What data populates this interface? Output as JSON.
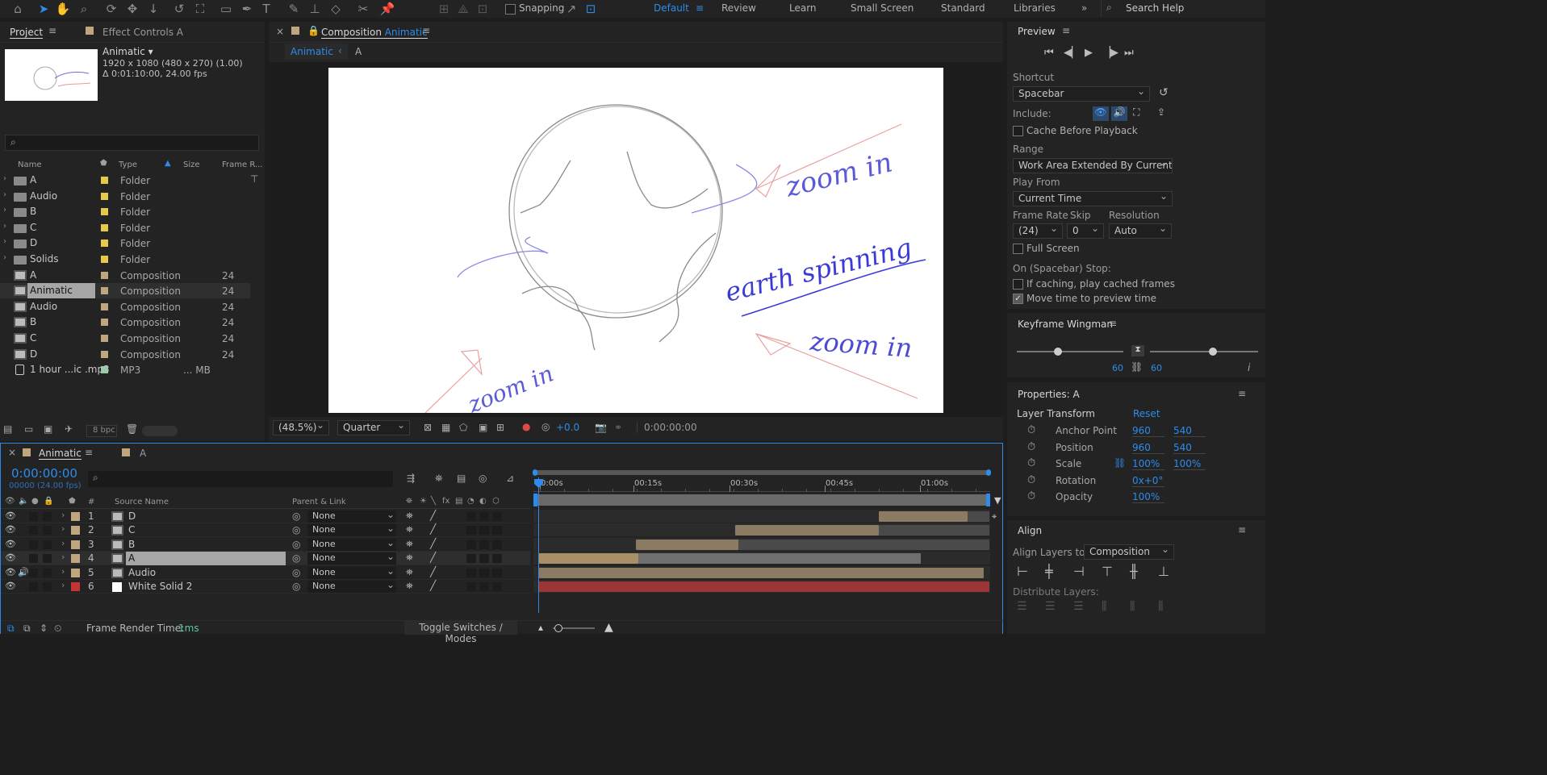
{
  "toolbar": {
    "snapping_label": "Snapping",
    "workspaces": [
      "Default",
      "Review",
      "Learn",
      "Small Screen",
      "Standard",
      "Libraries"
    ],
    "search_placeholder": "Search Help"
  },
  "project": {
    "tab_label": "Project",
    "effect_tab_label": "Effect Controls A",
    "comp_name": "Animatic",
    "comp_info_line1": "1920 x 1080  (480 x 270) (1.00)",
    "comp_info_line2": "Δ 0:01:10:00, 24.00 fps",
    "columns": {
      "name": "Name",
      "type": "Type",
      "size": "Size",
      "frame_rate": "Frame R..."
    },
    "items": [
      {
        "name": "A",
        "kind": "folder",
        "type": "Folder",
        "size": "",
        "fps": "",
        "color": "#e6c84a"
      },
      {
        "name": "Audio",
        "kind": "folder",
        "type": "Folder",
        "size": "",
        "fps": "",
        "color": "#e6c84a"
      },
      {
        "name": "B",
        "kind": "folder",
        "type": "Folder",
        "size": "",
        "fps": "",
        "color": "#e6c84a"
      },
      {
        "name": "C",
        "kind": "folder",
        "type": "Folder",
        "size": "",
        "fps": "",
        "color": "#e6c84a"
      },
      {
        "name": "D",
        "kind": "folder",
        "type": "Folder",
        "size": "",
        "fps": "",
        "color": "#e6c84a"
      },
      {
        "name": "Solids",
        "kind": "folder",
        "type": "Folder",
        "size": "",
        "fps": "",
        "color": "#e6c84a"
      },
      {
        "name": "A",
        "kind": "comp",
        "type": "Composition",
        "size": "",
        "fps": "24",
        "color": "#bfa67f"
      },
      {
        "name": "Animatic",
        "kind": "comp",
        "type": "Composition",
        "size": "",
        "fps": "24",
        "color": "#bfa67f"
      },
      {
        "name": "Audio",
        "kind": "comp",
        "type": "Composition",
        "size": "",
        "fps": "24",
        "color": "#bfa67f"
      },
      {
        "name": "B",
        "kind": "comp",
        "type": "Composition",
        "size": "",
        "fps": "24",
        "color": "#bfa67f"
      },
      {
        "name": "C",
        "kind": "comp",
        "type": "Composition",
        "size": "",
        "fps": "24",
        "color": "#bfa67f"
      },
      {
        "name": "D",
        "kind": "comp",
        "type": "Composition",
        "size": "",
        "fps": "24",
        "color": "#bfa67f"
      },
      {
        "name": "1 hour ...ic .mp3",
        "kind": "audio",
        "type": "MP3",
        "size": "... MB",
        "fps": "",
        "color": "#9ec9a8"
      }
    ],
    "bpc_label": "8 bpc"
  },
  "composition": {
    "panel_title_prefix": "Composition",
    "panel_title_name": "Animatic",
    "breadcrumb_active": "Animatic",
    "breadcrumb_next": "A",
    "canvas_text": [
      "zoom in",
      "earth spinning",
      "zoom in",
      "zoom in"
    ],
    "zoom": "(48.5%)",
    "resolution": "Quarter",
    "exposure": "+0.0",
    "timecode": "0:00:00:00"
  },
  "preview": {
    "title": "Preview",
    "shortcut_label": "Shortcut",
    "shortcut_value": "Spacebar",
    "include_label": "Include:",
    "cache_before_playback": "Cache Before Playback",
    "range_label": "Range",
    "range_value": "Work Area Extended By Current...",
    "play_from_label": "Play From",
    "play_from_value": "Current Time",
    "frame_rate_label": "Frame Rate",
    "frame_rate_value": "(24)",
    "skip_label": "Skip",
    "skip_value": "0",
    "resolution_label": "Resolution",
    "resolution_value": "Auto",
    "full_screen": "Full Screen",
    "stop_label": "On (Spacebar) Stop:",
    "if_caching": "If caching, play cached frames",
    "if_caching_checked": false,
    "move_time": "Move time to preview time",
    "move_time_checked": true
  },
  "keyframe_wingman": {
    "title": "Keyframe Wingman",
    "left_value": "60",
    "right_value": "60",
    "left_slider_fraction": 0.39,
    "right_slider_fraction": 0.58
  },
  "properties": {
    "title": "Properties: A",
    "section": "Layer Transform",
    "reset": "Reset",
    "rows": [
      {
        "label": "Anchor Point",
        "v1": "960",
        "v2": "540"
      },
      {
        "label": "Position",
        "v1": "960",
        "v2": "540"
      },
      {
        "label": "Scale",
        "v1": "100%",
        "v2": "100%"
      },
      {
        "label": "Rotation",
        "v1": "0x+0°",
        "v2": ""
      },
      {
        "label": "Opacity",
        "v1": "100%",
        "v2": ""
      }
    ]
  },
  "align": {
    "title": "Align",
    "align_layers_to_label": "Align Layers to:",
    "align_layers_to_value": "Composition",
    "distribute_label": "Distribute Layers:"
  },
  "timeline": {
    "tab_active": "Animatic",
    "tab_other": "A",
    "current_time": "0:00:00:00",
    "frames_info": "00000 (24.00 fps)",
    "columns": {
      "num": "#",
      "source": "Source Name",
      "parent": "Parent & Link"
    },
    "ruler_marks": [
      "0:00s",
      "00:15s",
      "00:30s",
      "00:45s",
      "01:00s"
    ],
    "layers": [
      {
        "num": "1",
        "name": "D",
        "parent": "None",
        "label_color": "#bfa67f",
        "is_solid": false,
        "selected": false,
        "has_audio": false
      },
      {
        "num": "2",
        "name": "C",
        "parent": "None",
        "label_color": "#bfa67f",
        "is_solid": false,
        "selected": false,
        "has_audio": false
      },
      {
        "num": "3",
        "name": "B",
        "parent": "None",
        "label_color": "#bfa67f",
        "is_solid": false,
        "selected": false,
        "has_audio": false
      },
      {
        "num": "4",
        "name": "A",
        "parent": "None",
        "label_color": "#bfa67f",
        "is_solid": false,
        "selected": true,
        "has_audio": false
      },
      {
        "num": "5",
        "name": "Audio",
        "parent": "None",
        "label_color": "#bfa67f",
        "is_solid": false,
        "selected": false,
        "has_audio": true
      },
      {
        "num": "6",
        "name": "White Solid 2",
        "parent": "None",
        "label_color": "#c43434",
        "is_solid": true,
        "selected": false,
        "has_audio": false
      }
    ],
    "render_time_label": "Frame Render Time:",
    "render_time_value": "1ms",
    "toggle_label": "Toggle Switches / Modes"
  }
}
